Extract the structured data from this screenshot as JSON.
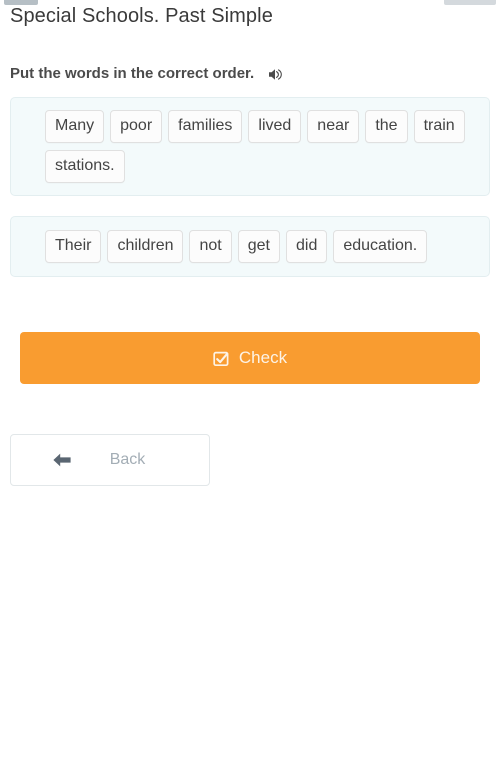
{
  "header": {
    "title": "Special Schools. Past Simple"
  },
  "instruction": {
    "text": "Put the words in the correct order.",
    "audio_icon": "speaker-icon"
  },
  "exercise": {
    "sentences": [
      {
        "words": [
          "Many",
          "poor",
          "families",
          "lived",
          "near",
          "the",
          "train",
          "stations."
        ]
      },
      {
        "words": [
          "Their",
          "children",
          "not",
          "get",
          "did",
          "education."
        ]
      }
    ]
  },
  "actions": {
    "check": {
      "label": "Check",
      "icon": "checked-box-icon",
      "color": "#f99c30",
      "text_color": "#fdf3e6"
    },
    "back": {
      "label": "Back",
      "icon": "arrow-left-icon",
      "text_color": "#a3adb5"
    }
  },
  "theme": {
    "page_background": "#ffffff",
    "box_background": "#f3fafb",
    "box_border": "#e3eef0",
    "chip_background": "#fcfcfc",
    "chip_border": "#e0e0e0",
    "title_color": "#3a3a3a"
  }
}
